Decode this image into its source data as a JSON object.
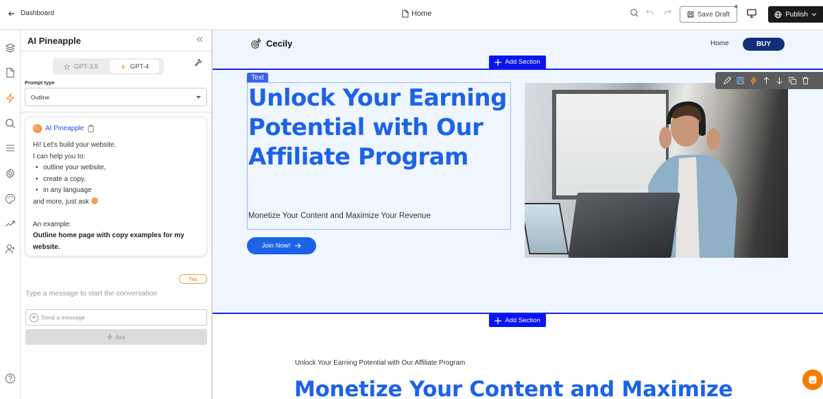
{
  "topbar": {
    "back_label": "Dashboard",
    "page_name": "Home",
    "save_draft_label": "Save Draft",
    "publish_label": "Publish",
    "status_dot_color": "#4caf50"
  },
  "rail": {
    "items": [
      "layers-icon",
      "page-icon",
      "ai-bolt-icon",
      "search-icon",
      "menu-icon",
      "settings-icon",
      "palette-icon",
      "analytics-icon",
      "add-user-icon"
    ],
    "active": "ai-bolt-icon",
    "help": "help-icon"
  },
  "panel": {
    "title": "AI Pineapple",
    "models": [
      {
        "label": "GPT-3.5",
        "active": false
      },
      {
        "label": "GPT-4",
        "active": true
      }
    ],
    "prompt_type_label": "Prompt type",
    "prompt_type_value": "Outline",
    "chat": {
      "sender": "AI Pineapple",
      "greeting": "Hi! Let's build your website.",
      "intro": "I can help you to:",
      "bullets": [
        "outline your website,",
        "create a copy,",
        "in any language"
      ],
      "closing": "and more, just ask",
      "example_label": "An example:",
      "example_text": "Outline home page with copy examples for my website."
    },
    "yes_label": "Yes",
    "hint": "Type a message to start the conversation",
    "send_placeholder": "Send a message",
    "ask_label": "Ask"
  },
  "canvas": {
    "brand": "Cecily",
    "nav": {
      "home": "Home",
      "buy": "BUY"
    },
    "add_section_label": "Add Section",
    "text_tag": "Text",
    "hero": {
      "title": "Unlock Your Earning Potential with Our Affiliate Program",
      "subtitle": "Monetize Your Content and Maximize Your Revenue",
      "cta": "Join Now!"
    },
    "second": {
      "kicker": "Unlock Your Earning Potential with Our Affiliate Program",
      "title": "Monetize Your Content and Maximize"
    },
    "colors": {
      "accent": "#1d63e8",
      "section_line": "#1a22e6",
      "buy": "#10307a",
      "ai": "#f39a3a"
    }
  }
}
